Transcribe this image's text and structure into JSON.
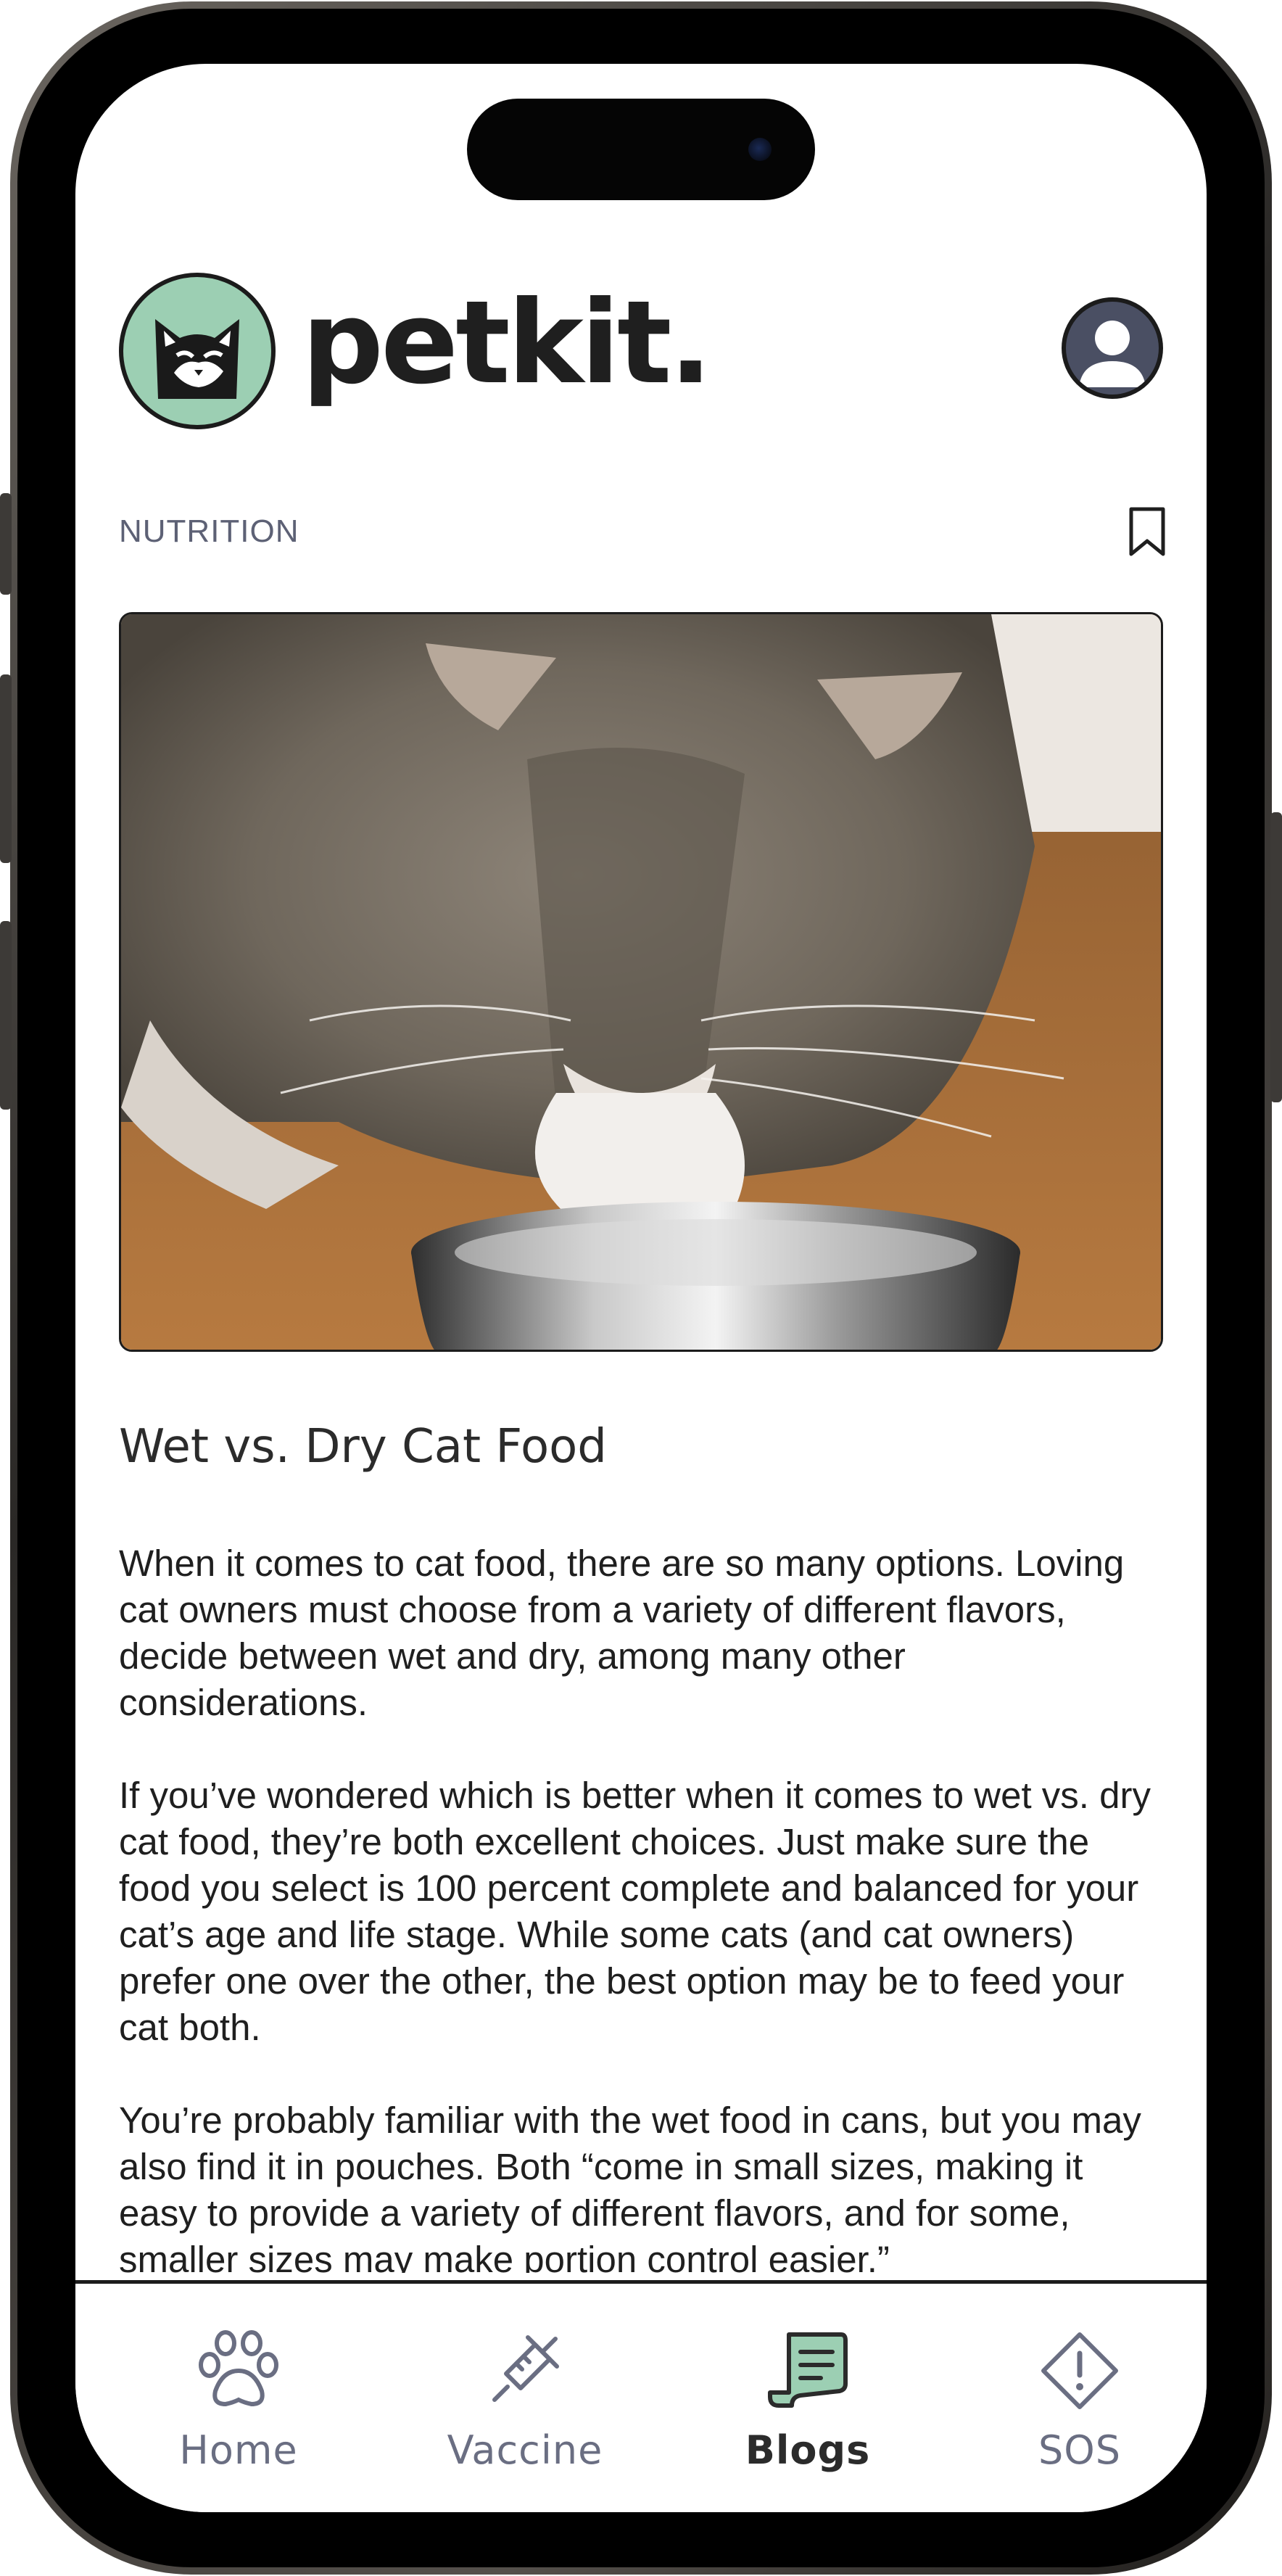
{
  "app": {
    "brand": "petkit.",
    "accent_color": "#9ccfb3",
    "icons": {
      "logo": "cat-logo-icon",
      "profile": "user-icon",
      "bookmark": "bookmark-icon"
    }
  },
  "article": {
    "category": "NUTRITION",
    "hero_image": "cat eating from a metal bowl",
    "title": "Wet vs. Dry Cat Food",
    "paragraphs": [
      "When it comes to cat food, there are so many options. Loving cat owners must choose from a variety of different flavors, decide between wet and dry, among many other considerations.",
      "If you’ve wondered which is better when it comes to wet vs. dry cat food, they’re both excellent choices. Just make sure the food you select is 100 percent complete and balanced for your cat’s age and life stage. While some cats (and cat owners) prefer one over the other, the best option may be to feed your cat both.",
      "You’re probably familiar with the wet food in cans, but you may also find it in pouches. Both “come in small sizes, making it easy to provide a variety of different flavors, and for some, smaller sizes may make portion control easier.”"
    ]
  },
  "nav": {
    "active": "Blogs",
    "items": [
      {
        "label": "Home",
        "icon": "paw-icon"
      },
      {
        "label": "Vaccine",
        "icon": "syringe-icon"
      },
      {
        "label": "Blogs",
        "icon": "scroll-icon"
      },
      {
        "label": "SOS",
        "icon": "alert-diamond-icon"
      }
    ]
  }
}
